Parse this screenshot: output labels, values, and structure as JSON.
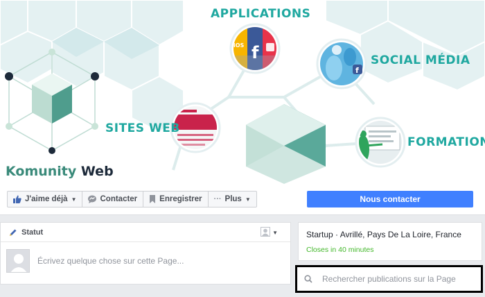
{
  "cover": {
    "labels": {
      "applications": "APPLICATIONS",
      "social": "SOCIAL MÉDIA",
      "sites": "SITES WEB",
      "formations": "FORMATIONS"
    },
    "app_icon_text": "iOS",
    "brand": {
      "part1": "Komunity",
      "part2": "Web"
    },
    "colors": {
      "teal": "#1fa8a0",
      "hex_light": "#dbeef0",
      "brand_green": "#3a8a7a"
    }
  },
  "actions": {
    "like_label": "J'aime déjà",
    "contact_label": "Contacter",
    "save_label": "Enregistrer",
    "more_label": "Plus",
    "cta_label": "Nous contacter",
    "cta_color": "#4080ff"
  },
  "composer": {
    "status_label": "Statut",
    "placeholder": "Écrivez quelque chose sur cette Page..."
  },
  "about": {
    "line": "Startup · Avrillé, Pays De La Loire, France",
    "hours": "Closes in 40 minutes"
  },
  "search": {
    "placeholder": "Rechercher publications sur la Page"
  },
  "icons": {
    "like": "thumbs-up-icon",
    "contact": "chat-bubble-icon",
    "save": "bookmark-icon",
    "more": "ellipsis-icon",
    "status": "pencil-icon",
    "audience": "person-icon",
    "search": "search-icon"
  }
}
